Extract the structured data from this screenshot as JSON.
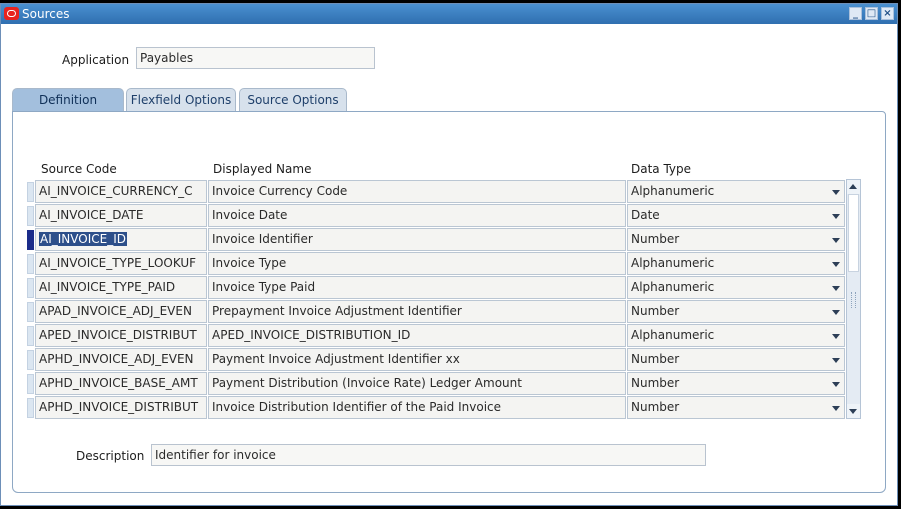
{
  "window": {
    "title": "Sources"
  },
  "header": {
    "application_label": "Application",
    "application_value": "Payables"
  },
  "tabs": [
    {
      "label": "Definition",
      "active": true
    },
    {
      "label": "Flexfield Options",
      "active": false
    },
    {
      "label": "Source Options",
      "active": false
    }
  ],
  "table": {
    "columns": {
      "source_code": "Source Code",
      "displayed_name": "Displayed Name",
      "data_type": "Data Type"
    },
    "rows": [
      {
        "source_code": "AI_INVOICE_CURRENCY_C",
        "displayed_name": "Invoice Currency Code",
        "data_type": "Alphanumeric"
      },
      {
        "source_code": "AI_INVOICE_DATE",
        "displayed_name": "Invoice Date",
        "data_type": "Date"
      },
      {
        "source_code": "AI_INVOICE_ID",
        "displayed_name": "Invoice Identifier",
        "data_type": "Number",
        "current": true
      },
      {
        "source_code": "AI_INVOICE_TYPE_LOOKUF",
        "displayed_name": "Invoice Type",
        "data_type": "Alphanumeric"
      },
      {
        "source_code": "AI_INVOICE_TYPE_PAID",
        "displayed_name": "Invoice Type Paid",
        "data_type": "Alphanumeric"
      },
      {
        "source_code": "APAD_INVOICE_ADJ_EVEN",
        "displayed_name": "Prepayment Invoice Adjustment Identifier",
        "data_type": "Number"
      },
      {
        "source_code": "APED_INVOICE_DISTRIBUT",
        "displayed_name": "APED_INVOICE_DISTRIBUTION_ID",
        "data_type": "Alphanumeric"
      },
      {
        "source_code": "APHD_INVOICE_ADJ_EVEN",
        "displayed_name": "Payment Invoice Adjustment Identifier  xx",
        "data_type": "Number"
      },
      {
        "source_code": "APHD_INVOICE_BASE_AMT",
        "displayed_name": "Payment Distribution (Invoice Rate) Ledger Amount",
        "data_type": "Number"
      },
      {
        "source_code": "APHD_INVOICE_DISTRIBUT",
        "displayed_name": "Invoice Distribution Identifier of the Paid Invoice",
        "data_type": "Number"
      }
    ]
  },
  "footer": {
    "description_label": "Description",
    "description_value": "Identifier for invoice"
  }
}
